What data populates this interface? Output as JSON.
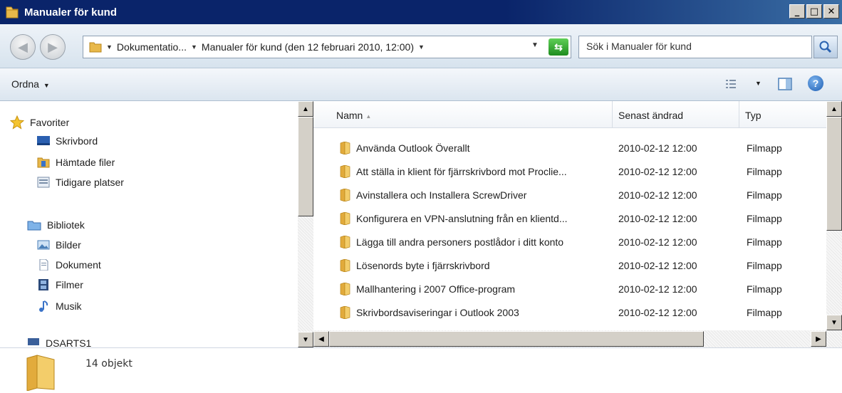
{
  "window": {
    "title": "Manualer för kund",
    "controls": [
      "_",
      "□",
      "✕"
    ]
  },
  "address_bar": {
    "back_icon": "back-arrow-icon",
    "forward_icon": "forward-arrow-icon",
    "breadcrumbs": [
      "Dokumentatio...",
      "Manualer för kund (den 12 februari 2010, 12:00)"
    ],
    "search_placeholder": "Sök i Manualer för kund"
  },
  "command_bar": {
    "organize_label": "Ordna"
  },
  "nav_pane": {
    "favorites": {
      "label": "Favoriter",
      "items": [
        {
          "label": "Skrivbord",
          "icon": "desktop-icon"
        },
        {
          "label": "Hämtade filer",
          "icon": "downloads-icon"
        },
        {
          "label": "Tidigare platser",
          "icon": "recent-places-icon"
        }
      ]
    },
    "libraries": {
      "label": "Bibliotek",
      "items": [
        {
          "label": "Bilder",
          "icon": "pictures-icon"
        },
        {
          "label": "Dokument",
          "icon": "documents-icon"
        },
        {
          "label": "Filmer",
          "icon": "videos-icon"
        },
        {
          "label": "Musik",
          "icon": "music-icon"
        }
      ]
    },
    "computer_partial": {
      "label": "DSARTS1",
      "icon": "computer-icon"
    }
  },
  "file_list": {
    "columns": [
      "Namn",
      "Senast ändrad",
      "Typ"
    ],
    "rows": [
      {
        "name": "Använda Outlook Överallt",
        "modified": "2010-02-12 12:00",
        "type": "Filmapp"
      },
      {
        "name": "Att ställa  in klient för fjärrskrivbord mot Proclie...",
        "modified": "2010-02-12 12:00",
        "type": "Filmapp"
      },
      {
        "name": "Avinstallera och Installera ScrewDriver",
        "modified": "2010-02-12 12:00",
        "type": "Filmapp"
      },
      {
        "name": "Konfigurera en VPN-anslutning från en klientd...",
        "modified": "2010-02-12 12:00",
        "type": "Filmapp"
      },
      {
        "name": "Lägga till andra personers postlådor i ditt konto",
        "modified": "2010-02-12 12:00",
        "type": "Filmapp"
      },
      {
        "name": "Lösenords byte i fjärrskrivbord",
        "modified": "2010-02-12 12:00",
        "type": "Filmapp"
      },
      {
        "name": "Mallhantering i 2007 Office-program",
        "modified": "2010-02-12 12:00",
        "type": "Filmapp"
      },
      {
        "name": "Skrivbordsaviseringar i Outlook 2003",
        "modified": "2010-02-12 12:00",
        "type": "Filmapp"
      }
    ]
  },
  "status_bar": {
    "item_count": "14 objekt"
  },
  "colors": {
    "titlebar": "#0a246a",
    "folder": "#e8b84a",
    "chrome": "#d4d0c8"
  }
}
